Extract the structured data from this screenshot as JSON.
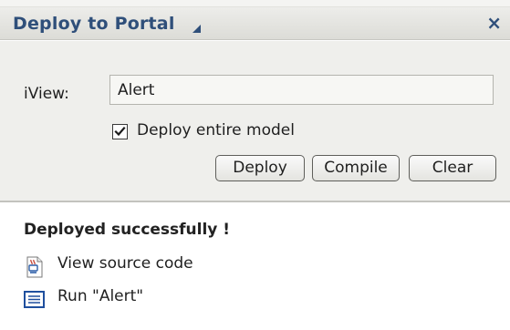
{
  "panel": {
    "title": "Deploy to Portal",
    "title_arrow_icon": "triangle-menu-icon",
    "close_icon": "close-icon",
    "close_glyph": "×"
  },
  "form": {
    "iview_label": "iView:",
    "iview_value": "Alert",
    "deploy_entire_model": {
      "label": "Deploy entire model",
      "checked": true
    },
    "buttons": {
      "deploy": "Deploy",
      "compile": "Compile",
      "clear": "Clear"
    }
  },
  "result": {
    "status": "Deployed successfully !",
    "links": [
      {
        "label": "View source code",
        "icon": "java-source-icon"
      },
      {
        "label": "Run \"Alert\"",
        "icon": "run-window-icon"
      }
    ]
  },
  "colors": {
    "title_text": "#2f4f7a",
    "form_background": "#efefec",
    "page_background": "#ffffff"
  }
}
